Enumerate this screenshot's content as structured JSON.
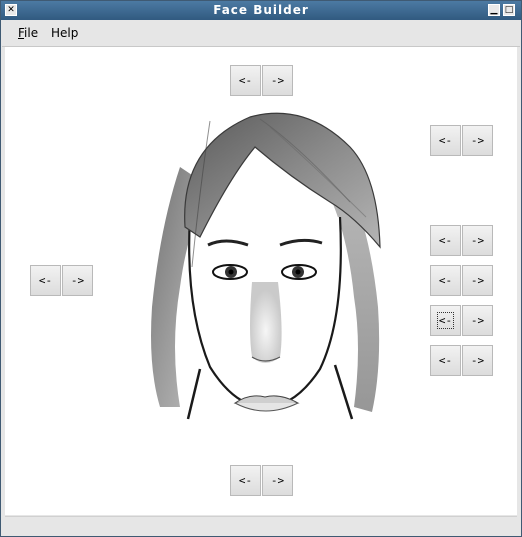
{
  "window": {
    "title": "Face Builder"
  },
  "titlebar": {
    "close_glyph": "✕",
    "min_glyph": "▁",
    "max_glyph": "□"
  },
  "menu": {
    "file": {
      "mnemonic": "F",
      "rest": "ile"
    },
    "help": {
      "mnemonic": "H",
      "rest": "elp"
    }
  },
  "controls": {
    "prev_label": "<-",
    "next_label": "->"
  }
}
